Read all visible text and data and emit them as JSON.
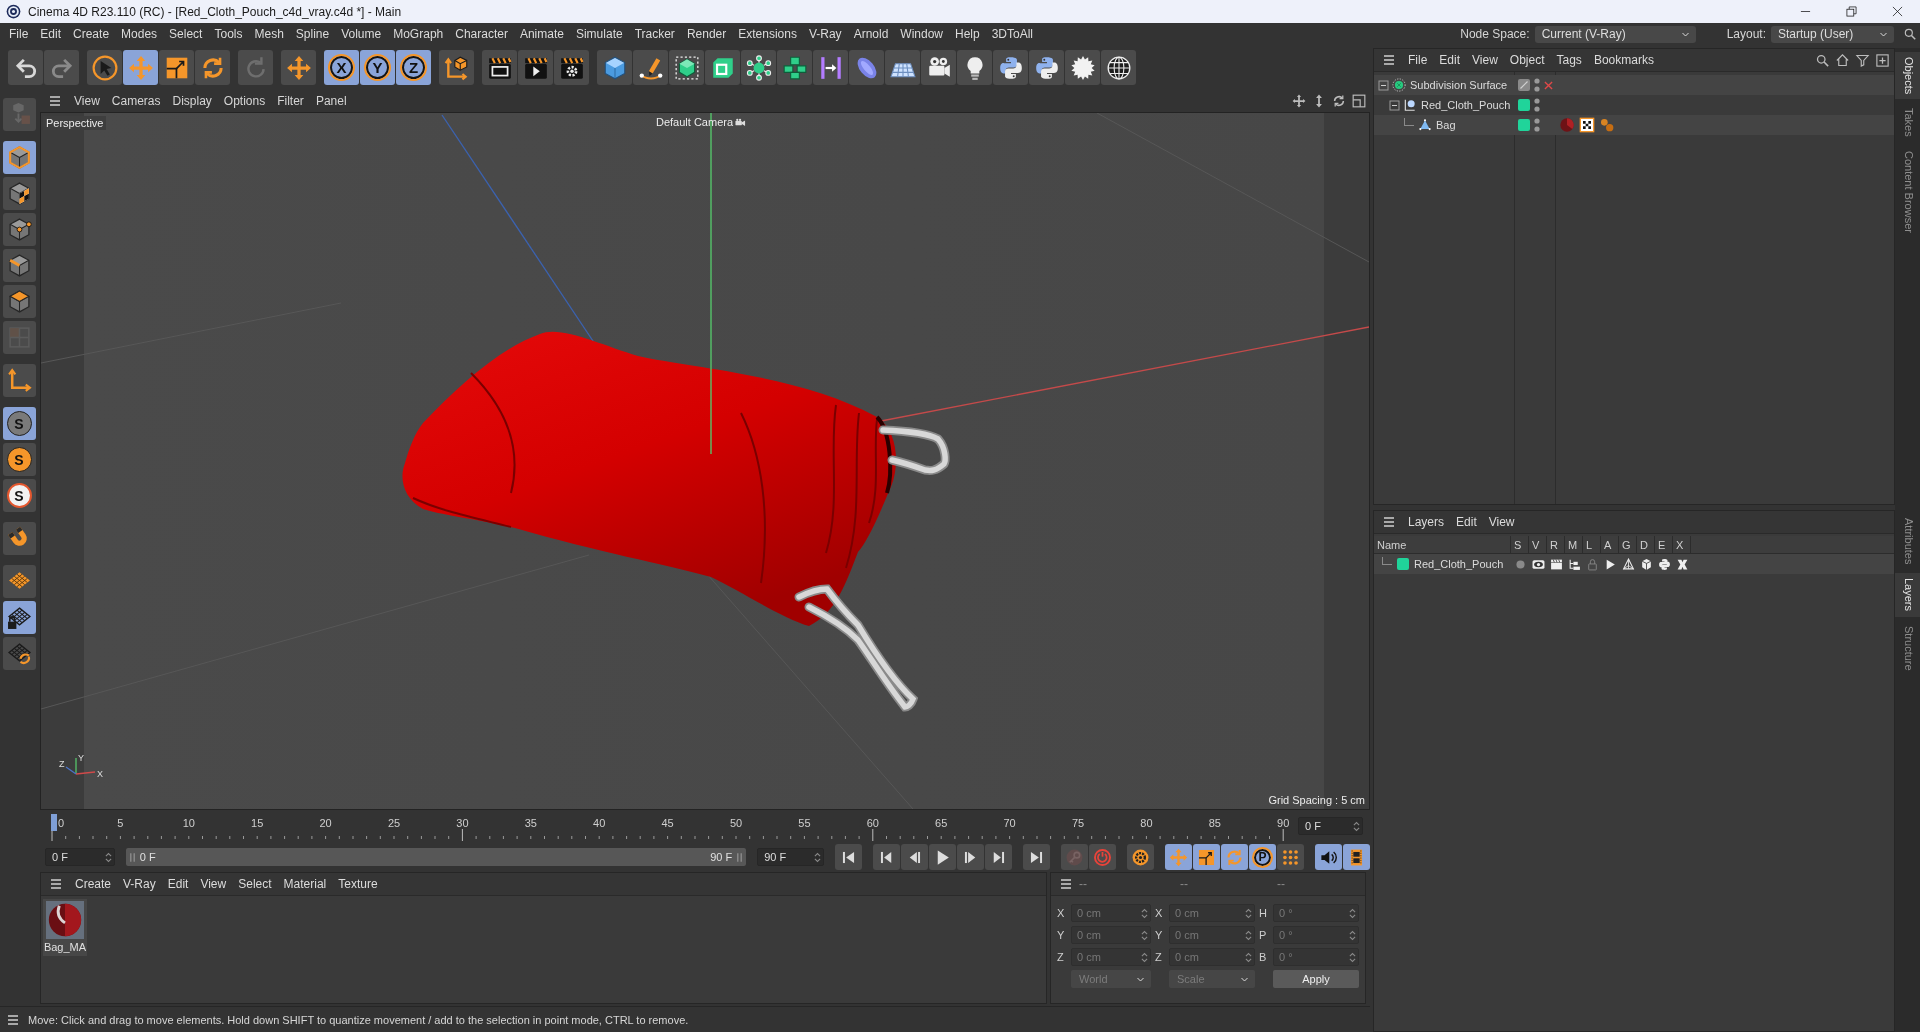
{
  "window": {
    "title": "Cinema 4D R23.110 (RC) - [Red_Cloth_Pouch_c4d_vray.c4d *] - Main"
  },
  "menu_bar": {
    "items": [
      "File",
      "Edit",
      "Create",
      "Modes",
      "Select",
      "Tools",
      "Mesh",
      "Spline",
      "Volume",
      "MoGraph",
      "Character",
      "Animate",
      "Simulate",
      "Tracker",
      "Render",
      "Extensions",
      "V-Ray",
      "Arnold",
      "Window",
      "Help",
      "3DToAll"
    ],
    "node_space": {
      "label": "Node Space:",
      "value": "Current (V-Ray)"
    },
    "layout": {
      "label": "Layout:",
      "value": "Startup (User)"
    }
  },
  "toolbar": {
    "groups": [
      [
        {
          "kind": "undo",
          "active": false,
          "disabled": false
        },
        {
          "kind": "redo",
          "active": false,
          "disabled": true
        }
      ],
      [
        {
          "kind": "select",
          "active": false,
          "disabled": false
        },
        {
          "kind": "move",
          "active": true,
          "disabled": false
        },
        {
          "kind": "scale",
          "active": false,
          "disabled": false
        },
        {
          "kind": "rotate",
          "active": false,
          "disabled": false
        }
      ],
      [
        {
          "kind": "psr",
          "active": false,
          "disabled": true
        }
      ],
      [
        {
          "kind": "move",
          "active": false,
          "disabled": false
        }
      ],
      [
        {
          "kind": "axis_lock",
          "label": "X",
          "active": true,
          "disabled": false
        },
        {
          "kind": "axis_lock",
          "label": "Y",
          "active": true,
          "disabled": false
        },
        {
          "kind": "axis_lock",
          "label": "Z",
          "active": true,
          "disabled": false
        }
      ],
      [
        {
          "kind": "coords",
          "active": false,
          "disabled": false
        }
      ],
      [
        {
          "kind": "render_view",
          "active": false,
          "disabled": false
        },
        {
          "kind": "render",
          "active": false,
          "disabled": false
        },
        {
          "kind": "render_settings",
          "active": false,
          "disabled": false
        }
      ],
      [
        {
          "kind": "cube",
          "active": false,
          "disabled": false
        },
        {
          "kind": "pen",
          "active": false,
          "disabled": false
        },
        {
          "kind": "subdiv",
          "active": false,
          "disabled": false
        },
        {
          "kind": "extrude",
          "active": false,
          "disabled": false
        },
        {
          "kind": "cloner",
          "active": false,
          "disabled": false
        },
        {
          "kind": "array",
          "active": false,
          "disabled": false
        },
        {
          "kind": "bend",
          "active": false,
          "disabled": false
        },
        {
          "kind": "field",
          "active": false,
          "disabled": false
        },
        {
          "kind": "floor",
          "active": false,
          "disabled": false
        },
        {
          "kind": "camera",
          "active": false,
          "disabled": false
        },
        {
          "kind": "light",
          "active": false,
          "disabled": false
        },
        {
          "kind": "python",
          "active": false,
          "disabled": false
        },
        {
          "kind": "python",
          "active": false,
          "disabled": false
        },
        {
          "kind": "sunburst",
          "active": false,
          "disabled": false
        },
        {
          "kind": "globe",
          "active": false,
          "disabled": false
        }
      ]
    ]
  },
  "tool_palette": {
    "groups": [
      [
        {
          "kind": "editable",
          "active": false,
          "disabled": true
        }
      ],
      [
        {
          "kind": "model",
          "active": true,
          "disabled": false
        },
        {
          "kind": "texture",
          "active": false,
          "disabled": false
        },
        {
          "kind": "points",
          "active": false,
          "disabled": false
        },
        {
          "kind": "edges",
          "active": false,
          "disabled": false
        },
        {
          "kind": "polygons",
          "active": false,
          "disabled": false
        },
        {
          "kind": "uv",
          "active": false,
          "disabled": true
        }
      ],
      [
        {
          "kind": "axis",
          "active": false,
          "disabled": false
        }
      ],
      [
        {
          "kind": "snap",
          "label": "S",
          "active": true,
          "disabled": false
        },
        {
          "kind": "snap_on",
          "label": "S",
          "active": false,
          "disabled": false
        },
        {
          "kind": "snap_alt",
          "label": "S",
          "active": false,
          "disabled": false
        }
      ],
      [
        {
          "kind": "magnet",
          "active": false,
          "disabled": false
        }
      ],
      [
        {
          "kind": "workplane",
          "active": false,
          "disabled": false
        },
        {
          "kind": "workplane_lock",
          "active": true,
          "disabled": false
        },
        {
          "kind": "workplane_rotate",
          "active": false,
          "disabled": false
        }
      ]
    ]
  },
  "viewport": {
    "menu": [
      "View",
      "Cameras",
      "Display",
      "Options",
      "Filter",
      "Panel"
    ],
    "view_name": "Perspective",
    "camera": "Default Camera",
    "grid_spacing": "Grid Spacing : 5 cm",
    "gizmo": {
      "x": "X",
      "y": "Y",
      "z": "Z"
    }
  },
  "timeline": {
    "ticks": [
      "0",
      "5",
      "10",
      "15",
      "20",
      "25",
      "30",
      "35",
      "40",
      "45",
      "50",
      "55",
      "60",
      "65",
      "70",
      "75",
      "80",
      "85",
      "90"
    ],
    "level": 0,
    "frame": "0 F"
  },
  "frame_controls": {
    "start": "0 F",
    "range": {
      "start": "0 F",
      "end": "90 F",
      "level": 1
    },
    "end": "90 F",
    "groups": [
      [
        {
          "kind": "start",
          "active": false,
          "disabled": false
        }
      ],
      [
        {
          "kind": "prev_key",
          "active": false,
          "disabled": false
        },
        {
          "kind": "prev_frame",
          "active": false,
          "disabled": false
        },
        {
          "kind": "play",
          "active": false,
          "disabled": false
        },
        {
          "kind": "next_frame",
          "active": false,
          "disabled": false
        },
        {
          "kind": "next_key",
          "active": false,
          "disabled": false
        }
      ],
      [
        {
          "kind": "end",
          "active": false,
          "disabled": false
        }
      ],
      [
        {
          "kind": "record",
          "active": false,
          "disabled": true
        },
        {
          "kind": "autokey",
          "active": false,
          "disabled": false
        }
      ],
      [
        {
          "kind": "keysel",
          "active": false,
          "disabled": false
        }
      ],
      [
        {
          "kind": "move",
          "active": true,
          "disabled": false
        },
        {
          "kind": "scale",
          "active": true,
          "disabled": false
        },
        {
          "kind": "rotate",
          "active": true,
          "disabled": false
        },
        {
          "kind": "param",
          "label": "P",
          "active": true,
          "disabled": false
        },
        {
          "kind": "dotgrid",
          "active": false,
          "disabled": false
        }
      ],
      [
        {
          "kind": "sound",
          "active": true,
          "disabled": false
        },
        {
          "kind": "film",
          "active": true,
          "disabled": false
        }
      ]
    ]
  },
  "materials": {
    "menu": [
      "Create",
      "V-Ray",
      "Edit",
      "View",
      "Select",
      "Material",
      "Texture"
    ],
    "items": [
      {
        "name": "Bag_MA"
      }
    ]
  },
  "coordinates": {
    "disabled": true,
    "headers": [
      "--",
      "--",
      "--"
    ],
    "columns": [
      {
        "fields": [
          {
            "axis": "X",
            "value": "0 cm"
          },
          {
            "axis": "Y",
            "value": "0 cm"
          },
          {
            "axis": "Z",
            "value": "0 cm"
          }
        ]
      },
      {
        "fields": [
          {
            "axis": "X",
            "value": "0 cm"
          },
          {
            "axis": "Y",
            "value": "0 cm"
          },
          {
            "axis": "Z",
            "value": "0 cm"
          }
        ]
      },
      {
        "fields": [
          {
            "axis": "H",
            "value": "0 °"
          },
          {
            "axis": "P",
            "value": "0 °"
          },
          {
            "axis": "B",
            "value": "0 °"
          }
        ]
      }
    ],
    "dropdowns": [
      "World",
      "Scale"
    ],
    "apply": "Apply"
  },
  "status_bar": {
    "text": "Move: Click and drag to move elements. Hold down SHIFT to quantize movement / add to the selection in point mode, CTRL to remove."
  },
  "objects": {
    "menu": [
      "File",
      "Edit",
      "View",
      "Object",
      "Tags",
      "Bookmarks"
    ],
    "tree": [
      {
        "name": "Subdivision Surface",
        "kind": "subdivision",
        "enabled": false,
        "expanded": true,
        "children": [
          {
            "name": "Red_Cloth_Pouch",
            "kind": "null",
            "color": "#20d49a",
            "expanded": true,
            "children": [
              {
                "name": "Bag",
                "kind": "polygon",
                "color": "#20d49a",
                "tags": [
                  {
                    "kind": "material"
                  },
                  {
                    "kind": "checker"
                  },
                  {
                    "kind": "spheres"
                  }
                ]
              }
            ]
          }
        ]
      }
    ]
  },
  "layers": {
    "menu": [
      "Layers",
      "Edit",
      "View"
    ],
    "columns": [
      "Name",
      "S",
      "V",
      "R",
      "M",
      "L",
      "A",
      "G",
      "D",
      "E",
      "X"
    ],
    "rows": [
      {
        "name": "Red_Cloth_Pouch",
        "color": "#20d49a",
        "flags": [
          {
            "kind": "solo",
            "on": false
          },
          {
            "kind": "view",
            "on": true
          },
          {
            "kind": "render",
            "on": true
          },
          {
            "kind": "manager",
            "on": true
          },
          {
            "kind": "locked",
            "on": false
          },
          {
            "kind": "animation",
            "on": true
          },
          {
            "kind": "generators",
            "on": true
          },
          {
            "kind": "deformers",
            "on": true
          },
          {
            "kind": "expressions",
            "on": true
          },
          {
            "kind": "xrefs",
            "on": true
          }
        ]
      }
    ]
  },
  "side_tabs": {
    "upper": [
      {
        "label": "Objects",
        "selected": true
      },
      {
        "label": "Takes",
        "selected": false
      },
      {
        "label": "Content Browser",
        "selected": false
      }
    ],
    "lower": [
      {
        "label": "Attributes",
        "selected": false
      },
      {
        "label": "Layers",
        "selected": true
      },
      {
        "label": "Structure",
        "selected": false
      }
    ]
  }
}
